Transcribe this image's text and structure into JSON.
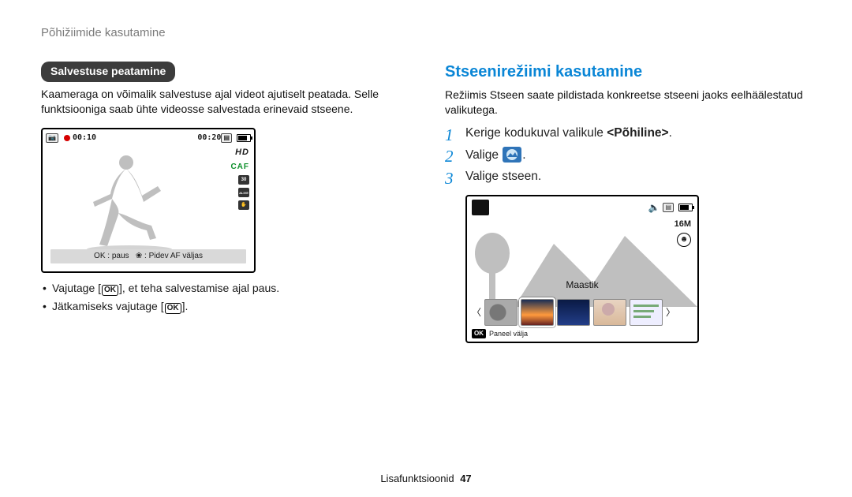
{
  "running_head": "Põhižiimide kasutamine",
  "left": {
    "pill": "Salvestuse peatamine",
    "paragraph": "Kaameraga on võimalik salvestuse ajal videot ajutiselt peatada. Selle funktsiooniga saab ühte videosse salvestada erinevaid stseene.",
    "screen": {
      "rec_time": "00:10",
      "total_time": "00:20",
      "hd_label": "HD",
      "caf_label": "CAF",
      "fps_top": "30",
      "alive_label": "ALIVE",
      "bottom_text": "OK : paus    : Pidev AF väljas"
    },
    "bullet1_pre": "Vajutage [",
    "bullet1_post": "], et teha salvestamise ajal paus.",
    "bullet2_pre": "Jätkamiseks vajutage [",
    "bullet2_post": "].",
    "ok_label": "OK"
  },
  "right": {
    "heading": "Stseenirežiimi kasutamine",
    "intro": "Režiimis Stseen saate pildistada konkreetse stseeni jaoks eelhäälestatud valikutega.",
    "step1_pre": "Kerige kodukuval valikule ",
    "step1_bold": "<Põhiline>",
    "step1_post": ".",
    "step2_pre": "Valige ",
    "step2_post": ".",
    "step3": "Valige stseen.",
    "screen": {
      "mp_label": "16M",
      "scene_name": "Maastik",
      "ok_label": "OK",
      "panel_text": "Paneel välja"
    }
  },
  "footer": {
    "section": "Lisafunktsioonid",
    "page": "47"
  }
}
